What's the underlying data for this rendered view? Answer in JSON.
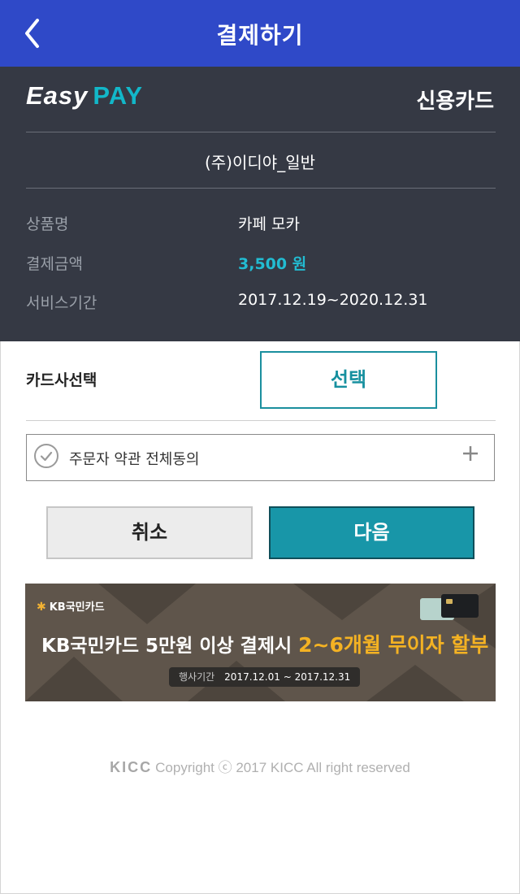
{
  "header": {
    "title": "결제하기",
    "back_icon": "chevron-left-icon",
    "bg_color": "#2f49c8"
  },
  "panel": {
    "logo_easy": "Easy",
    "logo_pay": "PAY",
    "pay_type": "신용카드",
    "merchant": "(주)이디야_일반",
    "rows": [
      {
        "label": "상품명",
        "value": "카페 모카"
      },
      {
        "label": "결제금액",
        "value": "3,500 원"
      },
      {
        "label": "서비스기간",
        "value": "2017.12.19~2020.12.31"
      }
    ],
    "bg_color": "#353944",
    "accent_color": "#22bcd2"
  },
  "card_select": {
    "label": "카드사선택",
    "button": "선택"
  },
  "agreement": {
    "text": "주문자 약관 전체동의",
    "check_icon": "check-circle-icon",
    "expand_icon": "plus-icon"
  },
  "actions": {
    "cancel": "취소",
    "next": "다음",
    "next_color": "#1896a8"
  },
  "banner": {
    "brand": "KB국민카드",
    "headline_prefix": "KB국민카드 5만원 이상 결제시 ",
    "headline_highlight": "2~6개월 무이자 할부",
    "period_label": "행사기간",
    "period": "2017.12.01 ~ 2017.12.31",
    "highlight_color": "#f4b223"
  },
  "footer": {
    "logo": "KICC",
    "text": "Copyright ⓒ 2017 KICC All right reserved"
  }
}
